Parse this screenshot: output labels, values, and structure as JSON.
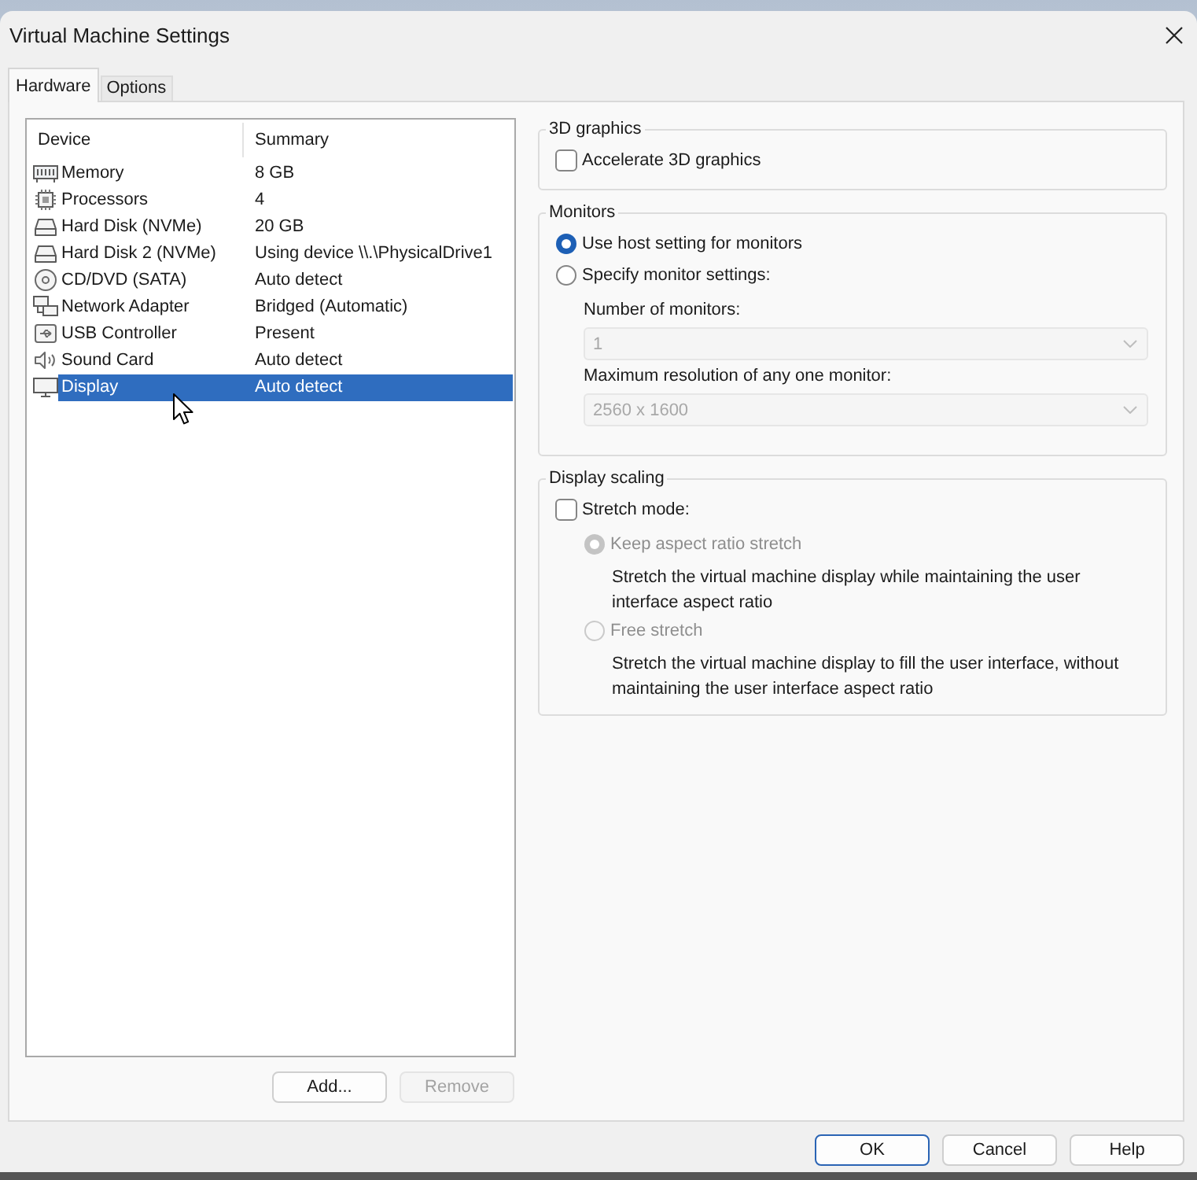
{
  "window": {
    "title": "Virtual Machine Settings"
  },
  "tabs": [
    {
      "label": "Hardware",
      "selected": true
    },
    {
      "label": "Options",
      "selected": false
    }
  ],
  "device_list": {
    "columns": [
      "Device",
      "Summary"
    ],
    "rows": [
      {
        "kind": "memory",
        "device": "Memory",
        "summary": "8 GB",
        "selected": false
      },
      {
        "kind": "processor",
        "device": "Processors",
        "summary": "4",
        "selected": false
      },
      {
        "kind": "hard_disk",
        "device": "Hard Disk (NVMe)",
        "summary": "20 GB",
        "selected": false
      },
      {
        "kind": "hard_disk",
        "device": "Hard Disk 2 (NVMe)",
        "summary": "Using device \\\\.\\PhysicalDrive1",
        "selected": false
      },
      {
        "kind": "cd_dvd",
        "device": "CD/DVD (SATA)",
        "summary": "Auto detect",
        "selected": false
      },
      {
        "kind": "network",
        "device": "Network Adapter",
        "summary": "Bridged (Automatic)",
        "selected": false
      },
      {
        "kind": "usb",
        "device": "USB Controller",
        "summary": "Present",
        "selected": false
      },
      {
        "kind": "sound",
        "device": "Sound Card",
        "summary": "Auto detect",
        "selected": false
      },
      {
        "kind": "display",
        "device": "Display",
        "summary": "Auto detect",
        "selected": true
      }
    ]
  },
  "device_buttons": [
    {
      "label": "Add...",
      "disabled": false
    },
    {
      "label": "Remove",
      "disabled": true
    }
  ],
  "groups": [
    {
      "title": "3D graphics",
      "items": [
        {
          "kind": "checkbox",
          "label": "Accelerate 3D graphics",
          "checked": false,
          "disabled": false
        }
      ]
    },
    {
      "title": "Monitors",
      "items": [
        {
          "kind": "radio",
          "label": "Use host setting for monitors",
          "selected": true,
          "disabled": false
        },
        {
          "kind": "radio",
          "label": "Specify monitor settings:",
          "selected": false,
          "disabled": false,
          "children": [
            {
              "kind": "dropdown",
              "label": "Number of monitors:",
              "value": "1",
              "disabled": true
            },
            {
              "kind": "dropdown",
              "label": "Maximum resolution of any one monitor:",
              "value": "2560 x 1600",
              "disabled": true
            }
          ]
        }
      ]
    },
    {
      "title": "Display scaling",
      "items": [
        {
          "kind": "checkbox",
          "label": "Stretch mode:",
          "checked": false,
          "disabled": false,
          "children": [
            {
              "kind": "radio",
              "label": "Keep aspect ratio stretch",
              "selected": true,
              "disabled": true,
              "description": "Stretch the virtual machine display while maintaining the user interface aspect ratio"
            },
            {
              "kind": "radio",
              "label": "Free stretch",
              "selected": false,
              "disabled": true,
              "description": "Stretch the virtual machine display to fill the user interface, without maintaining the user interface aspect ratio"
            }
          ]
        }
      ]
    }
  ],
  "dialog_buttons": [
    {
      "label": "OK",
      "default": true
    },
    {
      "label": "Cancel",
      "default": false
    },
    {
      "label": "Help",
      "default": false
    }
  ]
}
